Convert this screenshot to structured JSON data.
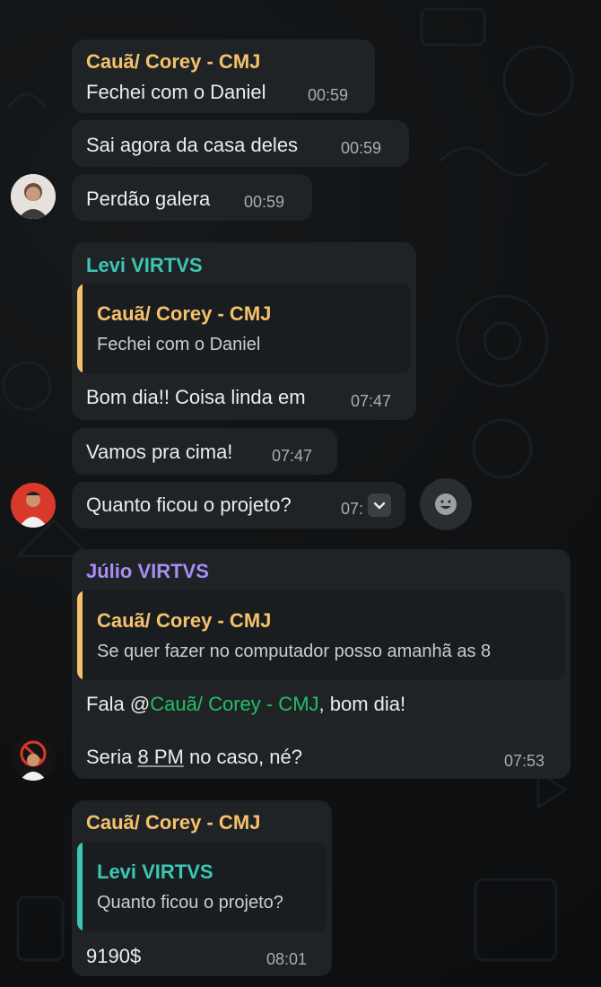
{
  "colors": {
    "name_caua": "#f5c26b",
    "name_levi": "#3cc7b5",
    "name_julio": "#a98cf5",
    "mention": "#21c063"
  },
  "messages": [
    {
      "sender": "Cauã/ Corey - CMJ",
      "text": "Fechei com o Daniel",
      "time": "00:59"
    },
    {
      "text": "Sai agora da casa deles",
      "time": "00:59"
    },
    {
      "text": "Perdão galera",
      "time": "00:59"
    },
    {
      "sender": "Levi VIRTVS",
      "quote": {
        "sender": "Cauã/ Corey - CMJ",
        "text": "Fechei com o Daniel"
      },
      "text": "Bom dia!! Coisa linda em",
      "time": "07:47"
    },
    {
      "text": "Vamos pra cima!",
      "time": "07:47"
    },
    {
      "text": "Quanto ficou o projeto?",
      "time": "07:"
    },
    {
      "sender": "Júlio VIRTVS",
      "quote": {
        "sender": "Cauã/ Corey - CMJ",
        "text": "Se quer fazer no computador posso amanhã as 8"
      },
      "line1_before": "Fala @",
      "line1_mention": "Cauã/ Corey - CMJ",
      "line1_after": ", bom dia!",
      "line2_before": "Seria ",
      "line2_link": "8 PM",
      "line2_after": " no caso, né?",
      "time": "07:53"
    },
    {
      "sender": "Cauã/ Corey - CMJ",
      "quote": {
        "sender": "Levi VIRTVS",
        "text": "Quanto ficou o projeto?"
      },
      "text": "9190$",
      "time": "08:01"
    }
  ],
  "icons": {
    "chevron": "chevron-down-icon",
    "react": "emoji-react-icon"
  }
}
